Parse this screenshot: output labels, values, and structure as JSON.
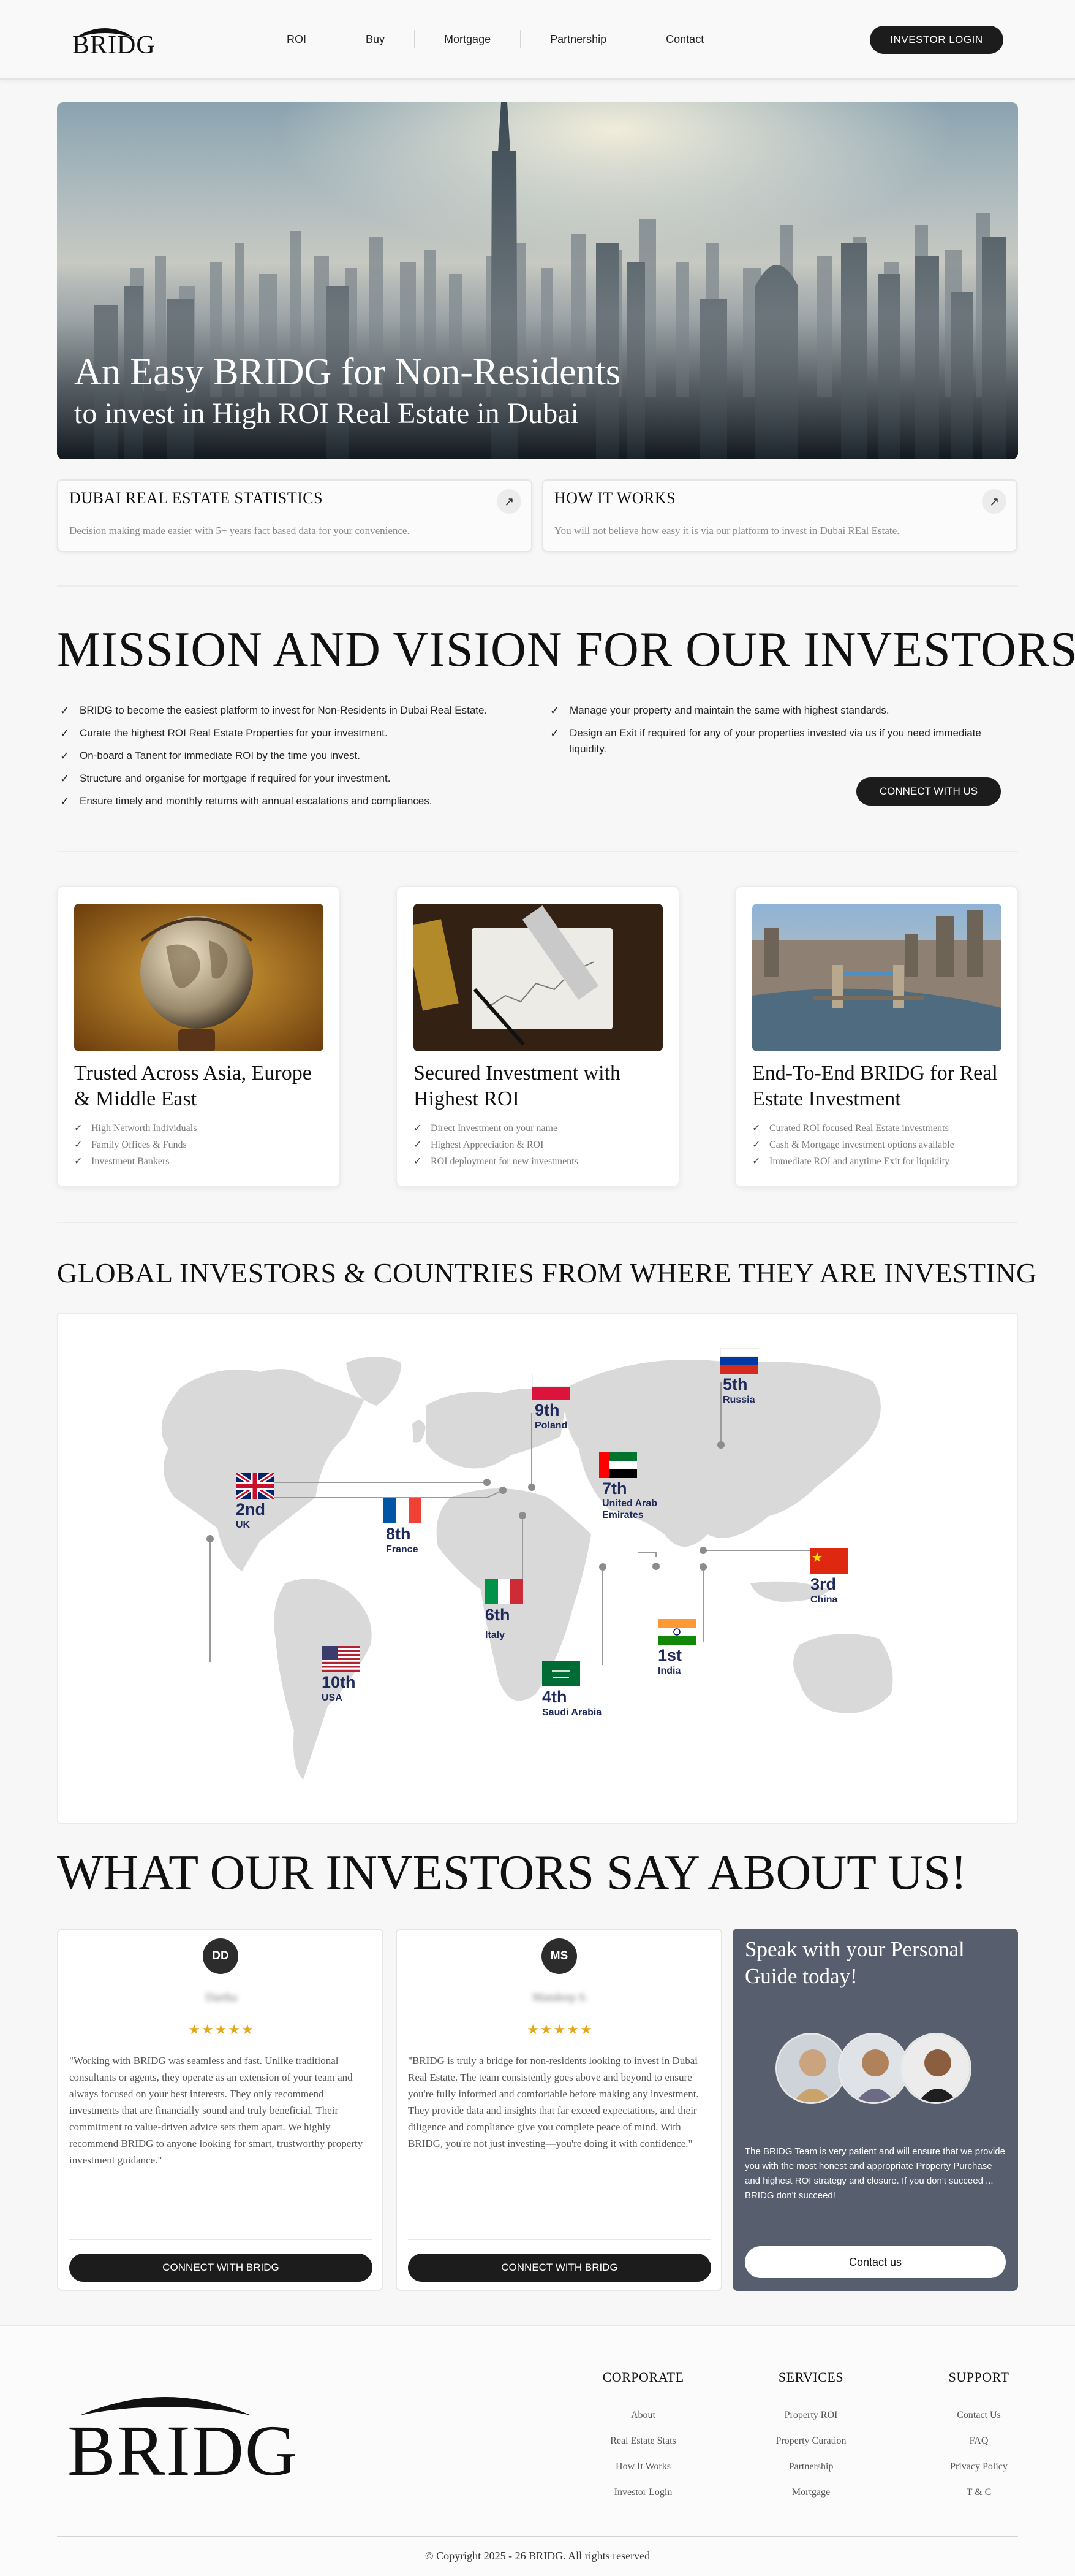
{
  "nav": {
    "logo": "BRIDG",
    "links": [
      "ROI",
      "Buy",
      "Mortgage",
      "Partnership",
      "Contact"
    ],
    "login": "INVESTOR LOGIN"
  },
  "hero": {
    "title_line1": "An Easy BRIDG for Non-Residents",
    "title_line2": "to invest in High ROI Real Estate in Dubai"
  },
  "stats": [
    {
      "title": "DUBAI REAL ESTATE STATISTICS",
      "subtitle": "Decision making made easier with 5+ years fact based data for your convenience.",
      "icon": "arrow-up-right-icon"
    },
    {
      "title": "HOW IT WORKS",
      "subtitle": "You will not believe how easy it is via our platform to invest in Dubai REal Estate.",
      "icon": "arrow-up-right-icon"
    }
  ],
  "mission": {
    "title": "MISSION AND VISION FOR OUR INVESTORS",
    "left": [
      "BRIDG to become the easiest platform to invest for Non-Residents in Dubai Real Estate.",
      "Curate the highest ROI Real Estate Properties for your investment.",
      "On-board a Tanent for immediate ROI by the time you invest.",
      "Structure and organise for mortgage if required for your investment.",
      "Ensure timely and monthly returns with annual escalations and compliances."
    ],
    "right": [
      "Manage your property and maintain the same with highest standards.",
      "Design an Exit if required for any of your properties invested via us if you need immediate liquidity."
    ],
    "button": "CONNECT WITH US"
  },
  "features": [
    {
      "title": "Trusted Across Asia, Europe & Middle East",
      "items": [
        "High Networth Individuals",
        "Family Offices & Funds",
        "Investment Bankers"
      ]
    },
    {
      "title": "Secured Investment with Highest ROI",
      "items": [
        "Direct Investment on your name",
        "Highest Appreciation & ROI",
        "ROI deployment for new investments"
      ]
    },
    {
      "title": "End-To-End BRIDG for Real Estate Investment",
      "items": [
        "Curated ROI focused Real Estate investments",
        "Cash & Mortgage investment options available",
        "Immediate ROI and anytime Exit for liquidity"
      ]
    }
  ],
  "global": {
    "title": "GLOBAL INVESTORS & COUNTRIES FROM WHERE THEY ARE INVESTING",
    "countries": [
      {
        "rank": "9th",
        "name": "Poland"
      },
      {
        "rank": "5th",
        "name": "Russia"
      },
      {
        "rank": "2nd",
        "name": "UK"
      },
      {
        "rank": "8th",
        "name": "France"
      },
      {
        "rank": "7th",
        "name": "United Arab Emirates"
      },
      {
        "rank": "3rd",
        "name": "China"
      },
      {
        "rank": "6th",
        "name": "Italy"
      },
      {
        "rank": "1st",
        "name": "India"
      },
      {
        "rank": "10th",
        "name": "USA"
      },
      {
        "rank": "4th",
        "name": "Saudi Arabia"
      }
    ]
  },
  "testimonials": {
    "title": "WHAT OUR INVESTORS SAY ABOUT US!",
    "items": [
      {
        "initials": "DD",
        "name": "Dartha",
        "stars": "★★★★★",
        "quote": "\"Working with BRIDG was seamless and fast. Unlike traditional consultants or agents, they operate as an extension of your team and always focused on your best interests. They only recommend investments that are financially sound and truly beneficial. Their commitment to value-driven advice sets them apart. We highly recommend BRIDG to anyone looking for smart, trustworthy property investment guidance.\"",
        "button": "CONNECT WITH BRIDG"
      },
      {
        "initials": "MS",
        "name": "Mandeep S.",
        "stars": "★★★★★",
        "quote": "\"BRIDG is truly a bridge for non-residents looking to invest in Dubai Real Estate. The team consistently goes above and beyond to ensure you're fully informed and comfortable before making any investment. They provide data and insights that far exceed expectations, and their diligence and compliance give you complete peace of mind. With BRIDG, you're not just investing—you're doing it with confidence.\"",
        "button": "CONNECT WITH BRIDG"
      }
    ],
    "guide": {
      "title": "Speak with your Personal Guide today!",
      "text": "The BRIDG Team is very patient and will ensure that we provide you with the most honest and appropriate Property Purchase and highest ROI strategy and closure. If you don't succeed ... BRIDG don't succeed!",
      "button": "Contact us"
    }
  },
  "footer": {
    "logo": "BRIDG",
    "columns": [
      {
        "heading": "CORPORATE",
        "links": [
          "About",
          "Real Estate Stats",
          "How It Works",
          "Investor Login"
        ]
      },
      {
        "heading": "SERVICES",
        "links": [
          "Property ROI",
          "Property Curation",
          "Partnership",
          "Mortgage"
        ]
      },
      {
        "heading": "SUPPORT",
        "links": [
          "Contact Us",
          "FAQ",
          "Privacy Policy",
          "T & C"
        ]
      }
    ],
    "copyright": "© Copyright 2025 - 26  BRIDG. All rights reserved"
  }
}
